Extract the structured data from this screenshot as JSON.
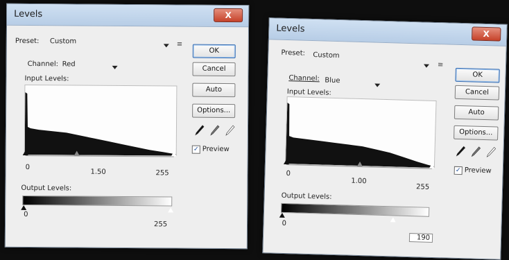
{
  "dialogs": [
    {
      "title": "Levels",
      "close_label": "X",
      "preset_label": "Preset:",
      "preset_value": "Custom",
      "channel_label": "Channel:",
      "channel_value": "Red",
      "input_levels_label": "Input Levels:",
      "input_values": [
        "0",
        "1.50",
        "255"
      ],
      "output_levels_label": "Output Levels:",
      "output_values": [
        "0",
        "255"
      ],
      "buttons": [
        "OK",
        "Cancel",
        "Auto",
        "Options..."
      ],
      "preview_label": "Preview",
      "preview_checked": true
    },
    {
      "title": "Levels",
      "close_label": "X",
      "preset_label": "Preset:",
      "preset_value": "Custom",
      "channel_label": "Channel:",
      "channel_value": "Blue",
      "input_levels_label": "Input Levels:",
      "input_values": [
        "0",
        "1.00",
        "255"
      ],
      "output_levels_label": "Output Levels:",
      "output_values": [
        "0",
        "190"
      ],
      "buttons": [
        "OK",
        "Cancel",
        "Auto",
        "Options..."
      ],
      "preview_label": "Preview",
      "preview_checked": true
    }
  ],
  "colors": {
    "titlebar": "#c3d6ec",
    "close_button": "#c6422a",
    "dialog_bg": "#eeeeee",
    "histogram_fill": "#111111",
    "screen_bg": "#0e0e0e"
  },
  "icons": {
    "menu": "list-menu-icon",
    "dropdown": "chevron-down-icon",
    "droppers": [
      "black-eyedropper-icon",
      "gray-eyedropper-icon",
      "white-eyedropper-icon"
    ]
  }
}
